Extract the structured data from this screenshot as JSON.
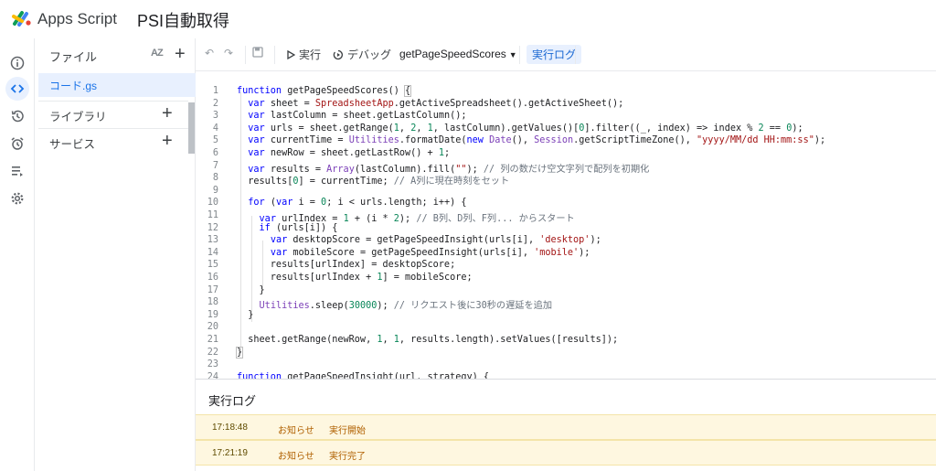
{
  "header": {
    "app_name": "Apps Script",
    "project_name": "PSI自動取得"
  },
  "files_panel": {
    "title": "ファイル",
    "sort_label": "AZ",
    "file_name": "コード.gs",
    "sections": [
      "ライブラリ",
      "サービス"
    ],
    "plus": "+"
  },
  "toolbar": {
    "undo": "↶",
    "redo": "↷",
    "save": "💾",
    "run_label": "実行",
    "debug_label": "デバッグ",
    "function_name": "getPageSpeedScores",
    "log_button": "実行ログ"
  },
  "editor": {
    "line_numbers": [
      "1",
      "2",
      "3",
      "4",
      "5",
      "6",
      "7",
      "8",
      "9",
      "10",
      "11",
      "12",
      "13",
      "14",
      "15",
      "16",
      "17",
      "18",
      "19",
      "20",
      "21",
      "22",
      "23",
      "24"
    ]
  },
  "log_panel": {
    "title": "実行ログ",
    "rows": [
      {
        "time": "17:18:48",
        "level": "お知らせ",
        "message": "実行開始"
      },
      {
        "time": "17:21:19",
        "level": "お知らせ",
        "message": "実行完了"
      }
    ]
  },
  "colors": {
    "accent": "#1a73e8",
    "log_bg": "#fef7e0",
    "keyword": "#0000ff",
    "string": "#a31515"
  }
}
